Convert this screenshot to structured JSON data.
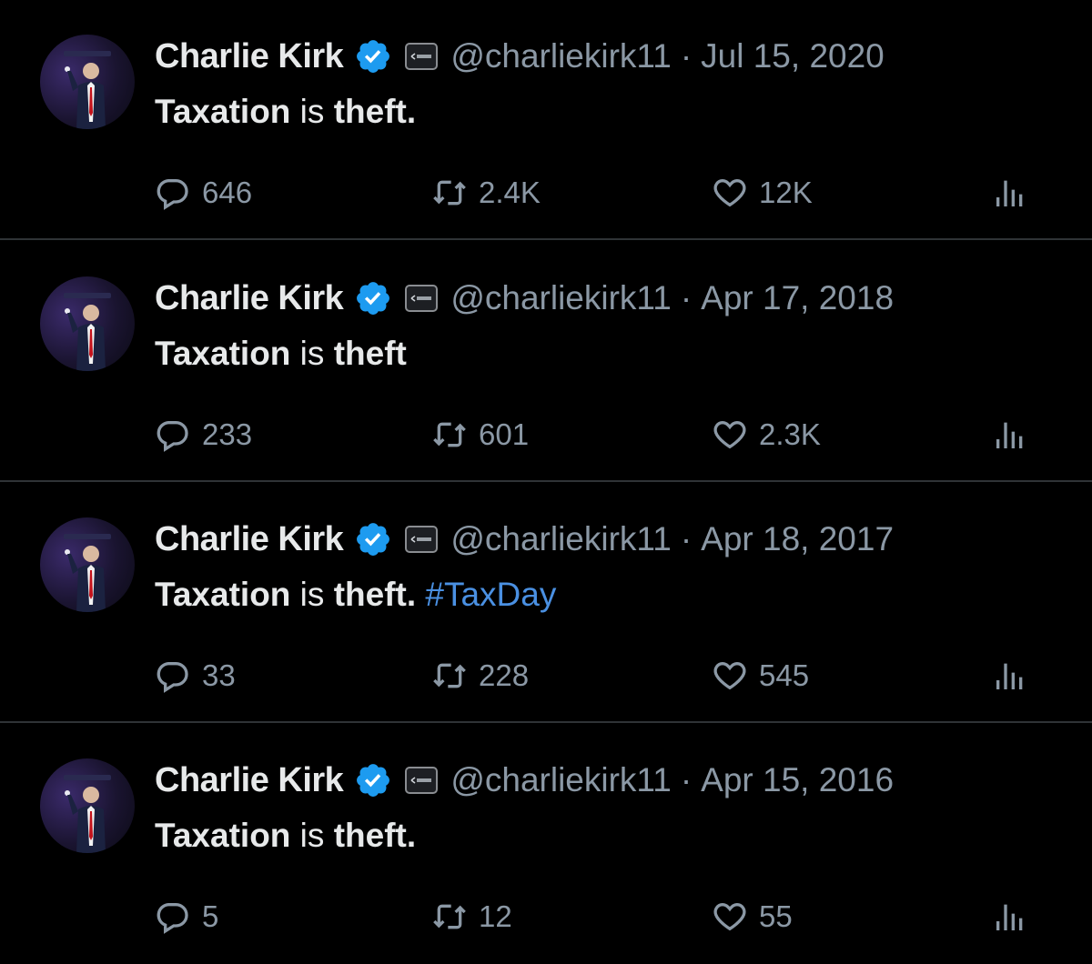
{
  "tweets": [
    {
      "author": "Charlie Kirk",
      "handle": "@charliekirk11",
      "separator": "·",
      "date": "Jul 15, 2020",
      "text_parts": [
        "Taxation",
        " is ",
        "theft."
      ],
      "hashtag": "",
      "replies": "646",
      "retweets": "2.4K",
      "likes": "12K"
    },
    {
      "author": "Charlie Kirk",
      "handle": "@charliekirk11",
      "separator": "·",
      "date": "Apr 17, 2018",
      "text_parts": [
        "Taxation",
        " is ",
        "theft"
      ],
      "hashtag": "",
      "replies": "233",
      "retweets": "601",
      "likes": "2.3K"
    },
    {
      "author": "Charlie Kirk",
      "handle": "@charliekirk11",
      "separator": "·",
      "date": "Apr 18, 2017",
      "text_parts": [
        "Taxation",
        " is ",
        "theft."
      ],
      "hashtag": " #TaxDay",
      "replies": "33",
      "retweets": "228",
      "likes": "545"
    },
    {
      "author": "Charlie Kirk",
      "handle": "@charliekirk11",
      "separator": "·",
      "date": "Apr 15, 2016",
      "text_parts": [
        "Taxation",
        " is ",
        "theft."
      ],
      "hashtag": "",
      "replies": "5",
      "retweets": "12",
      "likes": "55"
    }
  ],
  "icons": {
    "verified": "verified-badge-icon",
    "affiliation": "affiliation-badge-icon",
    "reply": "reply-icon",
    "retweet": "retweet-icon",
    "like": "heart-icon",
    "views": "views-icon"
  },
  "colors": {
    "background": "#000000",
    "text": "#e7e9ea",
    "muted": "#8b98a5",
    "link": "#4a90e2",
    "verified": "#1d9bf0",
    "divider": "#2f3336"
  }
}
